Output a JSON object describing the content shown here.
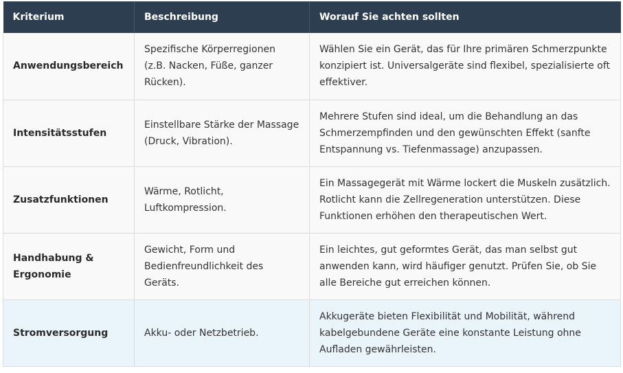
{
  "table": {
    "headers": [
      "Kriterium",
      "Beschreibung",
      "Worauf Sie achten sollten"
    ],
    "rows": [
      {
        "criterion": "Anwendungsbereich",
        "description": "Spezifische Körperregionen (z.B. Nacken, Füße, ganzer Rücken).",
        "advice": "Wählen Sie ein Gerät, das für Ihre primären Schmerzpunkte konzipiert ist. Universalgeräte sind flexibel, spezialisierte oft effektiver."
      },
      {
        "criterion": "Intensitätsstufen",
        "description": "Einstellbare Stärke der Massage (Druck, Vibration).",
        "advice": "Mehrere Stufen sind ideal, um die Behandlung an das Schmerzempfinden und den gewünschten Effekt (sanfte Entspannung vs. Tiefenmassage) anzupassen."
      },
      {
        "criterion": "Zusatzfunktionen",
        "description": "Wärme, Rotlicht, Luftkompression.",
        "advice": "Ein Massagegerät mit Wärme lockert die Muskeln zusätzlich. Rotlicht kann die Zellregeneration unterstützen. Diese Funktionen erhöhen den therapeutischen Wert."
      },
      {
        "criterion": "Handhabung & Ergonomie",
        "description": "Gewicht, Form und Bedienfreundlichkeit des Geräts.",
        "advice": "Ein leichtes, gut geformtes Gerät, das man selbst gut anwenden kann, wird häufiger genutzt. Prüfen Sie, ob Sie alle Bereiche gut erreichen können."
      },
      {
        "criterion": "Stromversorgung",
        "description": "Akku- oder Netzbetrieb.",
        "advice": "Akkugeräte bieten Flexibilität und Mobilität, während kabelgebundene Geräte eine konstante Leistung ohne Aufladen gewährleisten."
      }
    ]
  },
  "colors": {
    "header_bg": "#2c3e50",
    "row_bg": "#f9f9f9",
    "highlight_row_bg": "#eaf4fb"
  }
}
